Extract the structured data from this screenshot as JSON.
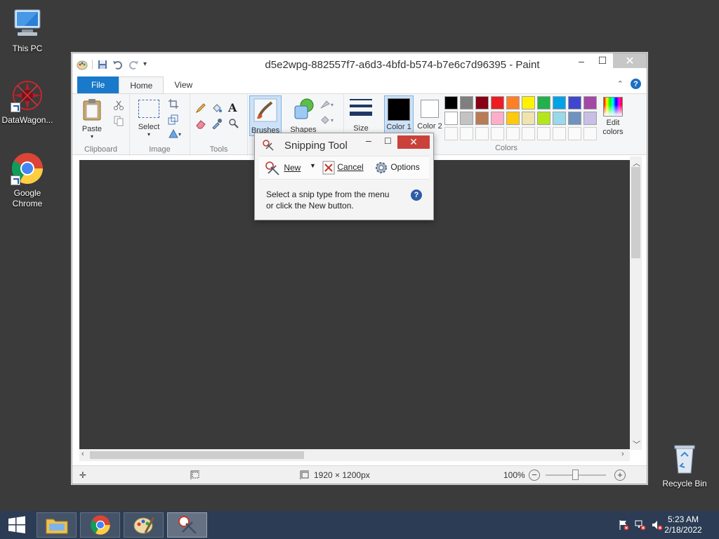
{
  "desktop": {
    "icons": [
      {
        "label": "This PC"
      },
      {
        "label": "DataWagon..."
      },
      {
        "label": "Google Chrome"
      },
      {
        "label": "Recycle Bin"
      }
    ]
  },
  "paint": {
    "title": "d5e2wpg-882557f7-a6d3-4bfd-b574-b7e6c7d96395 - Paint",
    "tabs": [
      "File",
      "Home",
      "View"
    ],
    "groups": {
      "clipboard": {
        "label": "Clipboard",
        "paste": "Paste"
      },
      "image": {
        "label": "Image",
        "select": "Select"
      },
      "tools": {
        "label": "Tools"
      },
      "brushes": "Brushes",
      "shapes": "Shapes",
      "size": "Size",
      "color1": "Color 1",
      "color2": "Color 2",
      "colors_label": "Colors",
      "edit_colors": "Edit colors"
    },
    "palette_row1": [
      "#000000",
      "#7f7f7f",
      "#880015",
      "#ed1c24",
      "#ff7f27",
      "#fff200",
      "#22b14c",
      "#00a2e8",
      "#3f48cc",
      "#a349a4"
    ],
    "palette_row2": [
      "#ffffff",
      "#c3c3c3",
      "#b97a57",
      "#ffaec9",
      "#ffc90e",
      "#efe4b0",
      "#b5e61d",
      "#99d9ea",
      "#7092be",
      "#c8bfe7"
    ],
    "status": {
      "dimensions": "1920 × 1200px",
      "zoom": "100%"
    }
  },
  "snipping": {
    "title": "Snipping Tool",
    "new": "New",
    "cancel": "Cancel",
    "options": "Options",
    "message_line1": "Select a snip type from the menu",
    "message_line2": "or click the New button."
  },
  "taskbar": {
    "time": "5:23 AM",
    "date": "2/18/2022"
  }
}
